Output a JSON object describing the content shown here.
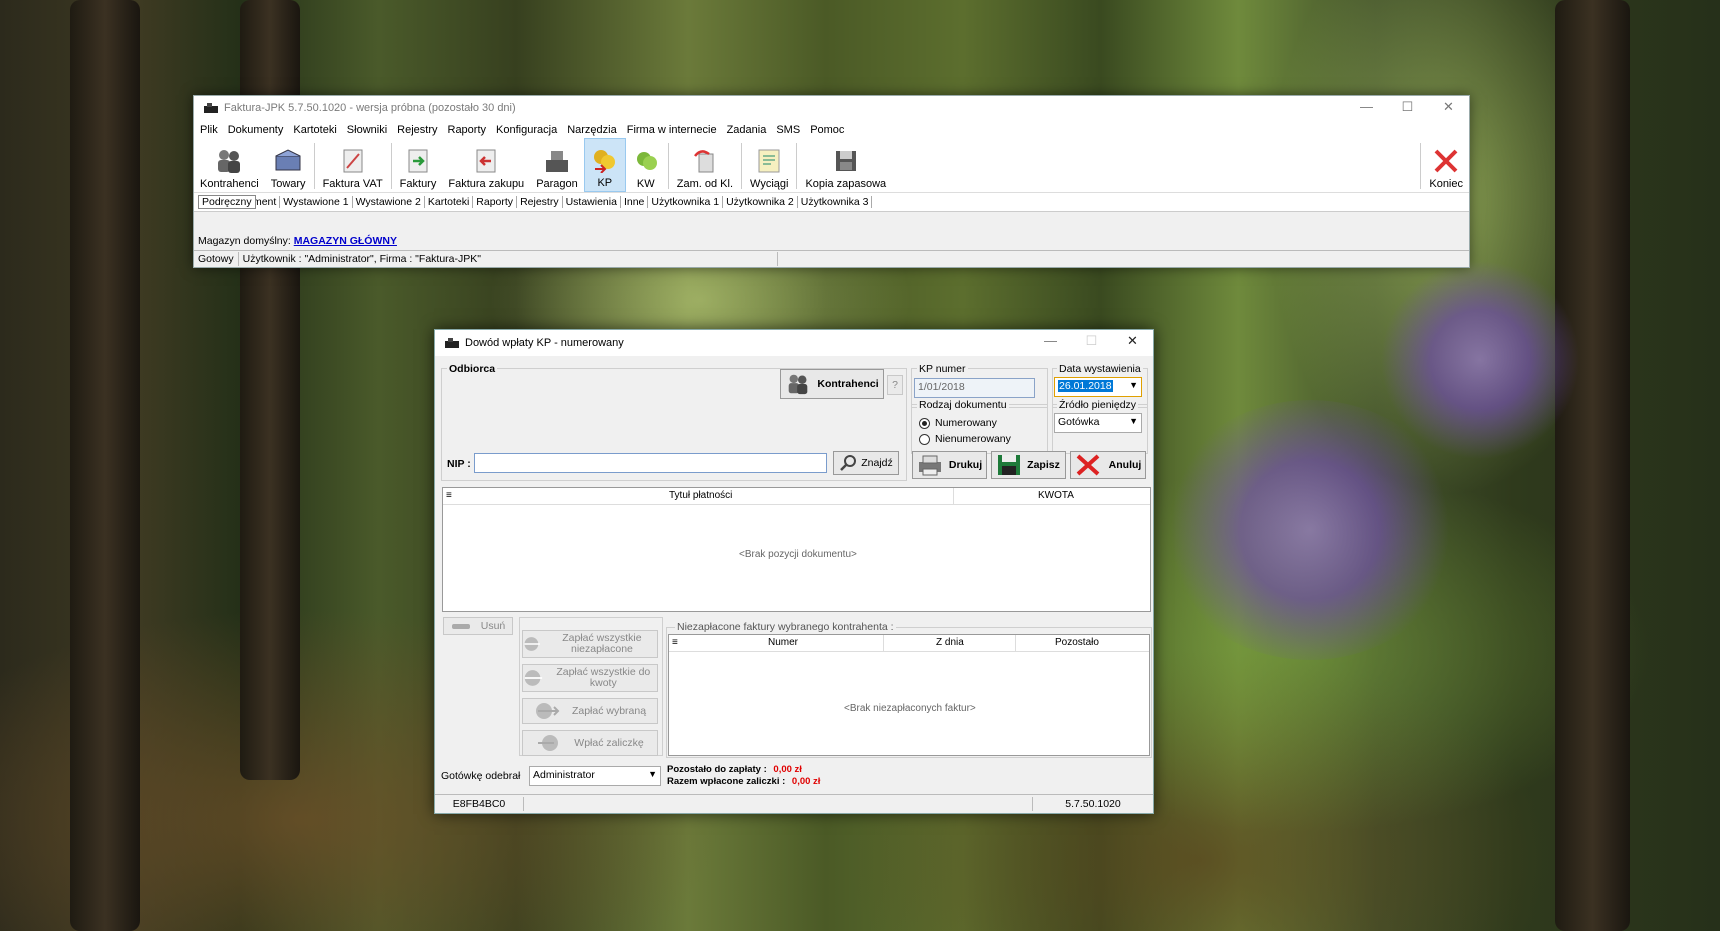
{
  "main": {
    "title": "Faktura-JPK 5.7.50.1020 - wersja próbna (pozostało 30 dni)",
    "menu": [
      "Plik",
      "Dokumenty",
      "Kartoteki",
      "Słowniki",
      "Rejestry",
      "Raporty",
      "Konfiguracja",
      "Narzędzia",
      "Firma w internecie",
      "Zadania",
      "SMS",
      "Pomoc"
    ],
    "toolbar": {
      "kontrahenci": "Kontrahenci",
      "towary": "Towary",
      "faktura_vat": "Faktura VAT",
      "faktury": "Faktury",
      "faktura_zakupu": "Faktura zakupu",
      "paragon": "Paragon",
      "kp": "KP",
      "kw": "KW",
      "zam": "Zam. od Kl.",
      "wyciagi": "Wyciągi",
      "kopia": "Kopia zapasowa",
      "koniec": "Koniec"
    },
    "tabs": [
      "Podręczny",
      "Nowy dokument",
      "Wystawione 1",
      "Wystawione 2",
      "Kartoteki",
      "Raporty",
      "Rejestry",
      "Ustawienia",
      "Inne",
      "Użytkownika 1",
      "Użytkownika 2",
      "Użytkownika 3"
    ],
    "magazyn_label": "Magazyn domyślny:",
    "magazyn_value": "MAGAZYN GŁÓWNY",
    "status_ready": "Gotowy",
    "status_user": "Użytkownik : \"Administrator\", Firma : \"Faktura-JPK\""
  },
  "dialog": {
    "title": "Dowód wpłaty KP - numerowany",
    "odbiorca_label": "Odbiorca",
    "kontrahenci_btn": "Kontrahenci",
    "help_btn": "?",
    "nip_label": "NIP :",
    "nip_value": "",
    "znajdz_btn": "Znajdź",
    "kp_numer_label": "KP numer",
    "kp_numer_value": "1/01/2018",
    "data_label": "Data wystawienia",
    "data_value": "26.01.2018",
    "rodzaj_label": "Rodzaj dokumentu",
    "radio_numerowany": "Numerowany",
    "radio_nienumerowany": "Nienumerowany",
    "zrodlo_label": "Źródło pieniędzy",
    "zrodlo_value": "Gotówka",
    "drukuj_btn": "Drukuj",
    "zapisz_btn": "Zapisz",
    "anuluj_btn": "Anuluj",
    "grid_col_tytul": "Tytuł płatności",
    "grid_col_kwota": "KWOTA",
    "grid_empty": "<Brak pozycji dokumentu>",
    "usun_btn": "Usuń",
    "zaplac_niezaplacone": "Zapłać wszystkie niezapłacone",
    "zaplac_do_kwoty": "Zapłać wszystkie do kwoty",
    "zaplac_wybrana": "Zapłać wybraną",
    "wplac_zaliczke": "Wpłać zaliczkę",
    "niezaplacone_label": "Niezapłacone faktury wybranego kontrahenta :",
    "col_numer": "Numer",
    "col_z_dnia": "Z dnia",
    "col_pozostalo": "Pozostało",
    "niezaplacone_empty": "<Brak niezapłaconych faktur>",
    "gotowke_label": "Gotówkę odebrał",
    "gotowke_value": "Administrator",
    "pozostalo_label": "Pozostało do zapłaty :",
    "pozostalo_value": "0,00 zł",
    "razem_label": "Razem wpłacone zaliczki :",
    "razem_value": "0,00 zł",
    "status_code": "E8FB4BC0",
    "status_version": "5.7.50.1020"
  }
}
